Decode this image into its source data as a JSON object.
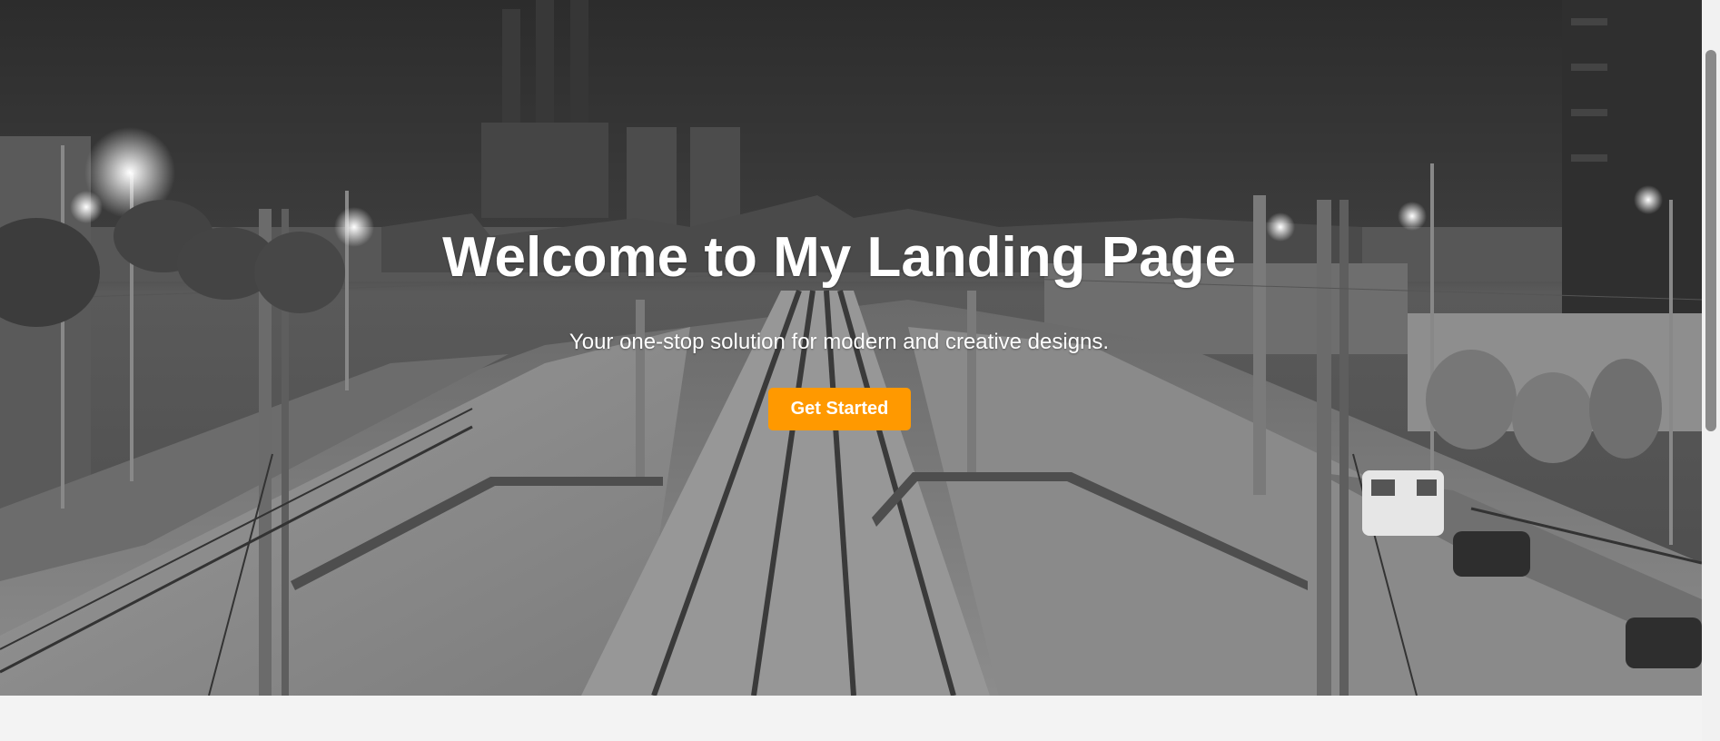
{
  "hero": {
    "title": "Welcome to My Landing Page",
    "subtitle": "Your one-stop solution for modern and creative designs.",
    "cta_label": "Get Started",
    "background_image": "grayscale-night-railway-city-skyline"
  },
  "colors": {
    "cta_background": "#ff9900",
    "cta_text": "#ffffff",
    "hero_text": "#ffffff",
    "page_background": "#f3f3f3"
  }
}
